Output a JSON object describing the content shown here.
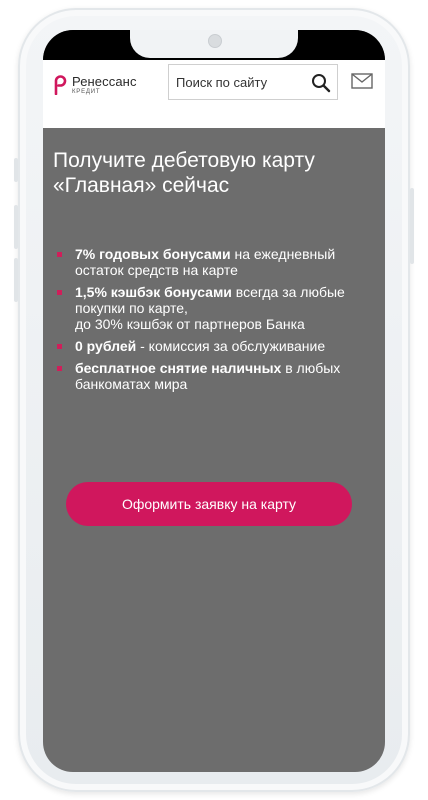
{
  "header": {
    "logo_name": "Ренессанс",
    "logo_sub": "КРЕДИТ",
    "search_placeholder": "Поиск по сайту",
    "brand_color": "#d0175d"
  },
  "hero": {
    "title_line1": "Получите дебетовую карту",
    "title_line2": "«Главная» сейчас",
    "benefits": [
      {
        "bold": "7% годовых бонусами",
        "rest": " на ежедневный остаток средств на карте"
      },
      {
        "bold": "1,5% кэшбэк бонусами",
        "rest": " всегда за любые покупки по карте,",
        "extra": "до 30% кэшбэк от партнеров Банка"
      },
      {
        "bold": "0 рублей",
        "rest": " - комиссия за обслуживание"
      },
      {
        "bold": "бесплатное снятие наличных",
        "rest": " в любых банкоматах мира"
      }
    ],
    "cta_label": "Оформить заявку на карту"
  },
  "icons": {
    "logo": "renaissance-logo-icon",
    "search": "search-icon",
    "mail": "mail-icon"
  },
  "colors": {
    "background": "#6d6d6d",
    "accent": "#d0175d",
    "bullet": "#d01e5a",
    "text": "#ffffff"
  }
}
